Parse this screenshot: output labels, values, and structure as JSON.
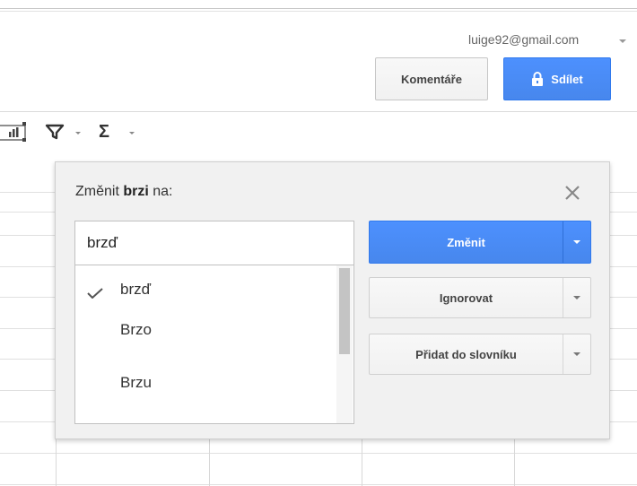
{
  "account": {
    "email": "luige92@gmail.com"
  },
  "header": {
    "comments_label": "Komentáře",
    "share_label": "Sdílet"
  },
  "toolbar": {
    "functions_symbol": "Σ",
    "icons": [
      "chart-icon",
      "filter-icon",
      "functions-icon"
    ]
  },
  "spellcheck": {
    "title_prefix": "Změnit ",
    "misspelled_word": "brzi",
    "title_suffix": " na:",
    "replacement_value": "brzď",
    "suggestions": [
      {
        "text": "brzď",
        "selected": true
      },
      {
        "text": "Brzo",
        "selected": false
      },
      {
        "text": "Brzu",
        "selected": false
      }
    ],
    "change_label": "Změnit",
    "ignore_label": "Ignorovat",
    "add_to_dictionary_label": "Přidat do slovníku"
  },
  "colors": {
    "accent_blue": "#4d90fe",
    "dialog_bg": "#f1f1f1"
  }
}
